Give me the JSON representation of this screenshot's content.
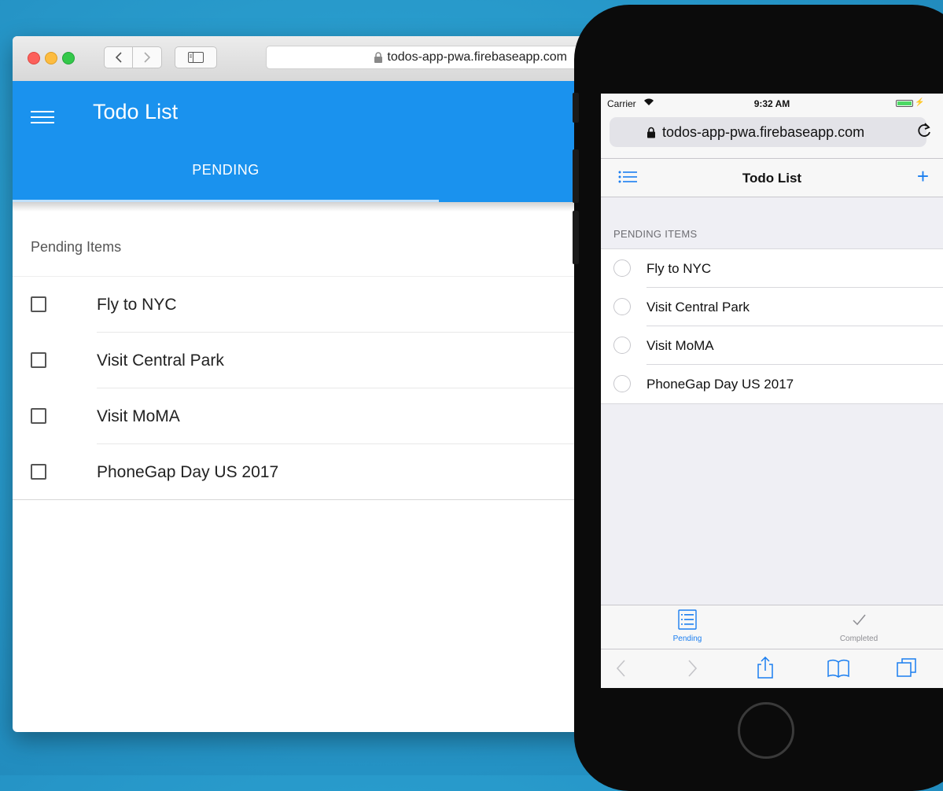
{
  "desktop": {
    "url": "todos-app-pwa.firebaseapp.com",
    "app_title": "Todo List",
    "tab_label": "PENDING",
    "section_header": "Pending Items",
    "items": [
      {
        "text": "Fly to NYC"
      },
      {
        "text": "Visit Central Park"
      },
      {
        "text": "Visit MoMA"
      },
      {
        "text": "PhoneGap Day US 2017"
      }
    ],
    "accent": "#1a92ee"
  },
  "mobile": {
    "carrier": "Carrier",
    "time": "9:32 AM",
    "url": "todos-app-pwa.firebaseapp.com",
    "nav_title": "Todo List",
    "section_header": "PENDING ITEMS",
    "items": [
      {
        "text": "Fly to NYC"
      },
      {
        "text": "Visit Central Park"
      },
      {
        "text": "Visit MoMA"
      },
      {
        "text": "PhoneGap Day US 2017"
      }
    ],
    "tabs": [
      {
        "label": "Pending",
        "icon": "list-icon",
        "active": true
      },
      {
        "label": "Completed",
        "icon": "checkmark-icon",
        "active": false
      }
    ],
    "toolbar_icons": [
      "back-icon",
      "forward-icon",
      "share-icon",
      "bookmarks-icon",
      "tabs-icon"
    ],
    "accent": "#1a7ef0"
  }
}
